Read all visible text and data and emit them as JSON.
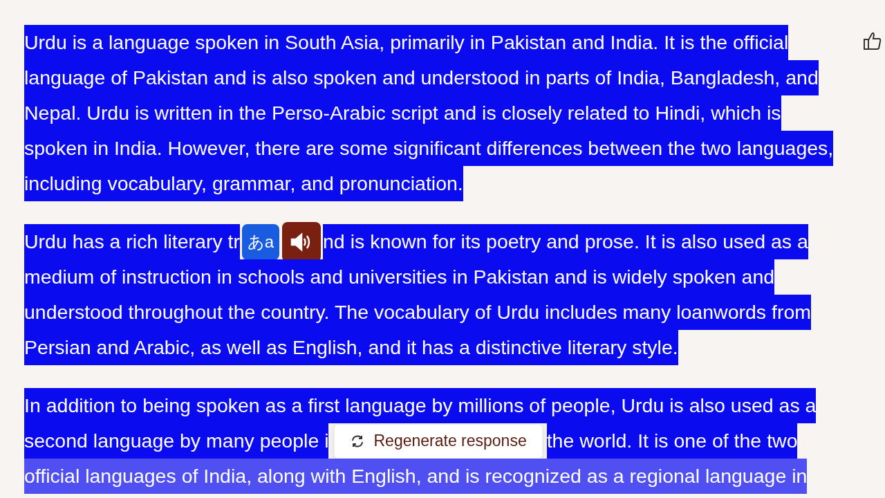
{
  "paragraphs": [
    {
      "selected": true,
      "lines": [
        {
          "kind": "text",
          "text": "Urdu is a language spoken in South Asia, primarily in Pakistan and India. It is the official"
        },
        {
          "kind": "text",
          "text": "language of Pakistan and is also spoken and understood in parts of India, Bangladesh, and"
        },
        {
          "kind": "text",
          "text": "Nepal. Urdu is written in the Perso-Arabic script and is closely related to Hindi, which is"
        },
        {
          "kind": "text",
          "text": "spoken in India. However, there are some significant differences between the two languages,"
        },
        {
          "kind": "text",
          "text": "including vocabulary, grammar, and pronunciation."
        }
      ]
    },
    {
      "selected": true,
      "lines": [
        {
          "kind": "popup",
          "before": "Urdu has a rich literary tr",
          "after": "nd is known for its poetry and prose. It is also used as a"
        },
        {
          "kind": "text",
          "text": "medium of instruction in schools and universities in Pakistan and is widely spoken and"
        },
        {
          "kind": "text",
          "text": "understood throughout the country. The vocabulary of Urdu includes many loanwords from"
        },
        {
          "kind": "text",
          "text": "Persian and Arabic, as well as English, and it has a distinctive literary style."
        }
      ]
    },
    {
      "selected": true,
      "lines": [
        {
          "kind": "text",
          "text": "In addition to being spoken as a first language by millions of people, Urdu is also used as a"
        },
        {
          "kind": "regenerate",
          "before": "second language by many people i",
          "after": "the world. It is one of the two"
        },
        {
          "kind": "faded",
          "text": "official languages of India, along with English, and is recognized as a regional language in"
        }
      ]
    }
  ],
  "translate_button": {
    "label": "あa"
  },
  "regenerate_button": {
    "label": "Regenerate response"
  }
}
